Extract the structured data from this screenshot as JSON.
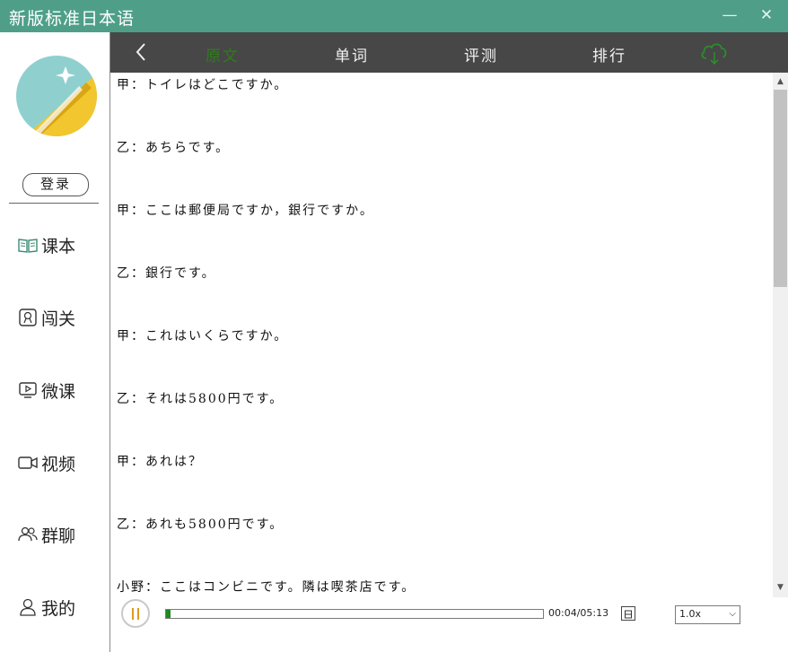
{
  "window": {
    "title": "新版标准日本语",
    "minimize_icon": "minimize-icon",
    "close_icon": "close-icon",
    "accent_color": "#4f9f88"
  },
  "sidebar": {
    "login_label": "登录",
    "items": [
      {
        "label": "课本",
        "icon": "book-icon"
      },
      {
        "label": "闯关",
        "icon": "badge-icon"
      },
      {
        "label": "微课",
        "icon": "video-lesson-icon"
      },
      {
        "label": "视频",
        "icon": "camera-icon"
      },
      {
        "label": "群聊",
        "icon": "group-icon"
      },
      {
        "label": "我的",
        "icon": "user-icon"
      }
    ]
  },
  "tabs": {
    "back_icon": "back-icon",
    "items": [
      {
        "label": "原文",
        "active": true
      },
      {
        "label": "单词",
        "active": false
      },
      {
        "label": "评测",
        "active": false
      },
      {
        "label": "排行",
        "active": false
      }
    ],
    "cloud_icon": "cloud-download-icon",
    "active_color": "#2e7d18"
  },
  "transcript": {
    "lines": [
      "甲：トイレはどこですか。",
      "乙：あちらです。",
      "甲：ここは郵便局ですか，銀行ですか。",
      "乙：銀行です。",
      "甲：これはいくらですか。",
      "乙：それは5800円です。",
      "甲：あれは？",
      "乙：あれも5800円です。",
      "小野：ここはコンビニです。隣は喫茶店です。"
    ]
  },
  "player": {
    "state_icon": "pause-icon",
    "progress": 0.013,
    "time": "00:04/05:13",
    "schedule_icon": "calendar-icon",
    "speed": "1.0x",
    "speed_icon": "chevron-down-icon"
  }
}
